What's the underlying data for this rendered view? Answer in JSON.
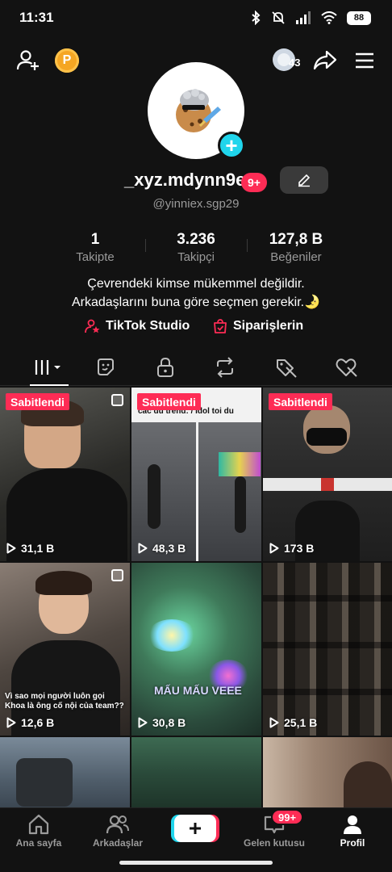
{
  "status_bar": {
    "time": "11:31",
    "battery": "88"
  },
  "top_bar": {
    "coin_label": "P",
    "story_count": "43"
  },
  "profile": {
    "username": "_xyz.mdynn9e",
    "notif_badge": "9+",
    "handle": "@yinniex.sgp29",
    "stats": [
      {
        "value": "1",
        "label": "Takipte"
      },
      {
        "value": "3.236",
        "label": "Takipçi"
      },
      {
        "value": "127,8 B",
        "label": "Beğeniler"
      }
    ],
    "bio_line1": "Çevrendeki kimse mükemmel değildir.",
    "bio_line2": "Arkadaşlarını buna göre seçmen gerekir.🌛",
    "links": {
      "studio": "TikTok Studio",
      "orders": "Siparişlerin"
    }
  },
  "tabs": [
    "videos-tab",
    "favorites-tab",
    "private-tab",
    "reposts-tab",
    "hidden-tab",
    "liked-tab"
  ],
  "videos": [
    {
      "pinned": "Sabitlendi",
      "views": "31,1 B",
      "bg": "#3b3a36",
      "caption": ""
    },
    {
      "pinned": "Sabitlendi",
      "views": "48,3 B",
      "bg": "#5b5f62",
      "caption": "các du trend: / Idol toi du"
    },
    {
      "pinned": "Sabitlendi",
      "views": "173 B",
      "bg": "#2c2c2c",
      "caption": ""
    },
    {
      "pinned": "",
      "views": "12,6 B",
      "bg": "#514844",
      "caption": "Vì sao mọi người luôn gọi Khoa là ông cố nội của team??"
    },
    {
      "pinned": "",
      "views": "30,8 B",
      "bg": "#3f6b4f",
      "caption": "MẤU MẤU VEEE"
    },
    {
      "pinned": "",
      "views": "25,1 B",
      "bg": "#2b2723",
      "caption": ""
    },
    {
      "pinned": "",
      "views": "",
      "bg": "#5a6876",
      "caption": ""
    },
    {
      "pinned": "",
      "views": "",
      "bg": "#2e4a3a",
      "caption": ""
    },
    {
      "pinned": "",
      "views": "",
      "bg": "#8a7060",
      "caption": ""
    }
  ],
  "bottom_nav": {
    "home": "Ana sayfa",
    "friends": "Arkadaşlar",
    "inbox": "Gelen kutusu",
    "inbox_badge": "99+",
    "profile": "Profil"
  },
  "colors": {
    "accent": "#fe2c55",
    "cyan": "#20d5ec",
    "bg": "#121212"
  }
}
